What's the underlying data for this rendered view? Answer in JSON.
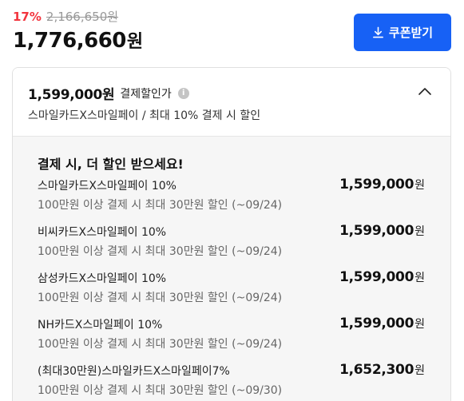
{
  "price": {
    "discount_rate": "17%",
    "original_price": "2,166,650원",
    "final_amount": "1,776,660",
    "final_unit": "원"
  },
  "coupon_button": {
    "label": "쿠폰받기",
    "icon": "download-icon"
  },
  "payment_discount": {
    "amount": "1,599,000원",
    "label": "결제할인가",
    "info_icon": "info-icon",
    "summary": "스마일카드X스마일페이 / 최대 10% 결제 시 할인",
    "toggle_icon": "chevron-up-icon"
  },
  "offers_section": {
    "title": "결제 시, 더 할인 받으세요!",
    "offers": [
      {
        "name": "스마일카드X스마일페이 10%",
        "detail": "100만원 이상 결제 시 최대 30만원 할인 (~09/24)",
        "amount": "1,599,000",
        "unit": "원"
      },
      {
        "name": "비씨카드X스마일페이 10%",
        "detail": "100만원 이상 결제 시 최대 30만원 할인 (~09/24)",
        "amount": "1,599,000",
        "unit": "원"
      },
      {
        "name": "삼성카드X스마일페이 10%",
        "detail": "100만원 이상 결제 시 최대 30만원 할인 (~09/24)",
        "amount": "1,599,000",
        "unit": "원"
      },
      {
        "name": "NH카드X스마일페이 10%",
        "detail": "100만원 이상 결제 시 최대 30만원 할인 (~09/24)",
        "amount": "1,599,000",
        "unit": "원"
      },
      {
        "name": "(최대30만원)스마일카드X스마일페이7%",
        "detail": "100만원 이상 결제 시 최대 30만원 할인 (~09/30)",
        "amount": "1,652,300",
        "unit": "원"
      }
    ]
  },
  "colors": {
    "accent": "#1761f5",
    "discount": "#f2343d",
    "panel_bg": "#f6f6f6"
  }
}
